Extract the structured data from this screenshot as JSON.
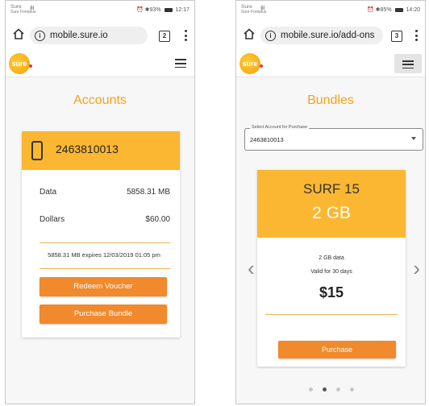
{
  "left_screen": {
    "status": {
      "carrier": "Sure",
      "carrier_sub": "Sure Foreplus",
      "signal": "ıll ıl",
      "alarm_battery": "⏰ ✱93%",
      "time": "12:17"
    },
    "browser": {
      "url": "mobile.sure.io",
      "tab_count": "2"
    },
    "logo_text": "sure",
    "page_title": "Accounts",
    "account": {
      "number": "2463810013",
      "rows": [
        {
          "label": "Data",
          "value": "5858.31 MB"
        },
        {
          "label": "Dollars",
          "value": "$60.00"
        }
      ],
      "expires_text": "5858.31 MB expires 12/03/2019 01:05 pm",
      "redeem_label": "Redeem Voucher",
      "purchase_label": "Purchase Bundle"
    }
  },
  "right_screen": {
    "status": {
      "carrier": "Sure",
      "carrier_sub": "Sure Foreplus",
      "signal": "ıll ıl",
      "alarm_battery": "⏰ ✱85%",
      "time": "14:20"
    },
    "browser": {
      "url": "mobile.sure.io/add-ons",
      "tab_count": "3"
    },
    "logo_text": "sure",
    "page_title": "Bundles",
    "select": {
      "legend": "Select Account for Purchase",
      "value": "2463810013"
    },
    "bundle": {
      "name": "SURF 15",
      "size": "2 GB",
      "data_text": "2 GB data",
      "valid_text": "Valid for 30 days",
      "price": "$15",
      "purchase_label": "Purchase"
    },
    "carousel": {
      "prev": "‹",
      "next": "›",
      "page_count": 4,
      "active_index": 1
    }
  },
  "colors": {
    "accent_yellow": "#fbb731",
    "button_orange": "#f08a2c",
    "title_orange": "#f7a21b"
  }
}
